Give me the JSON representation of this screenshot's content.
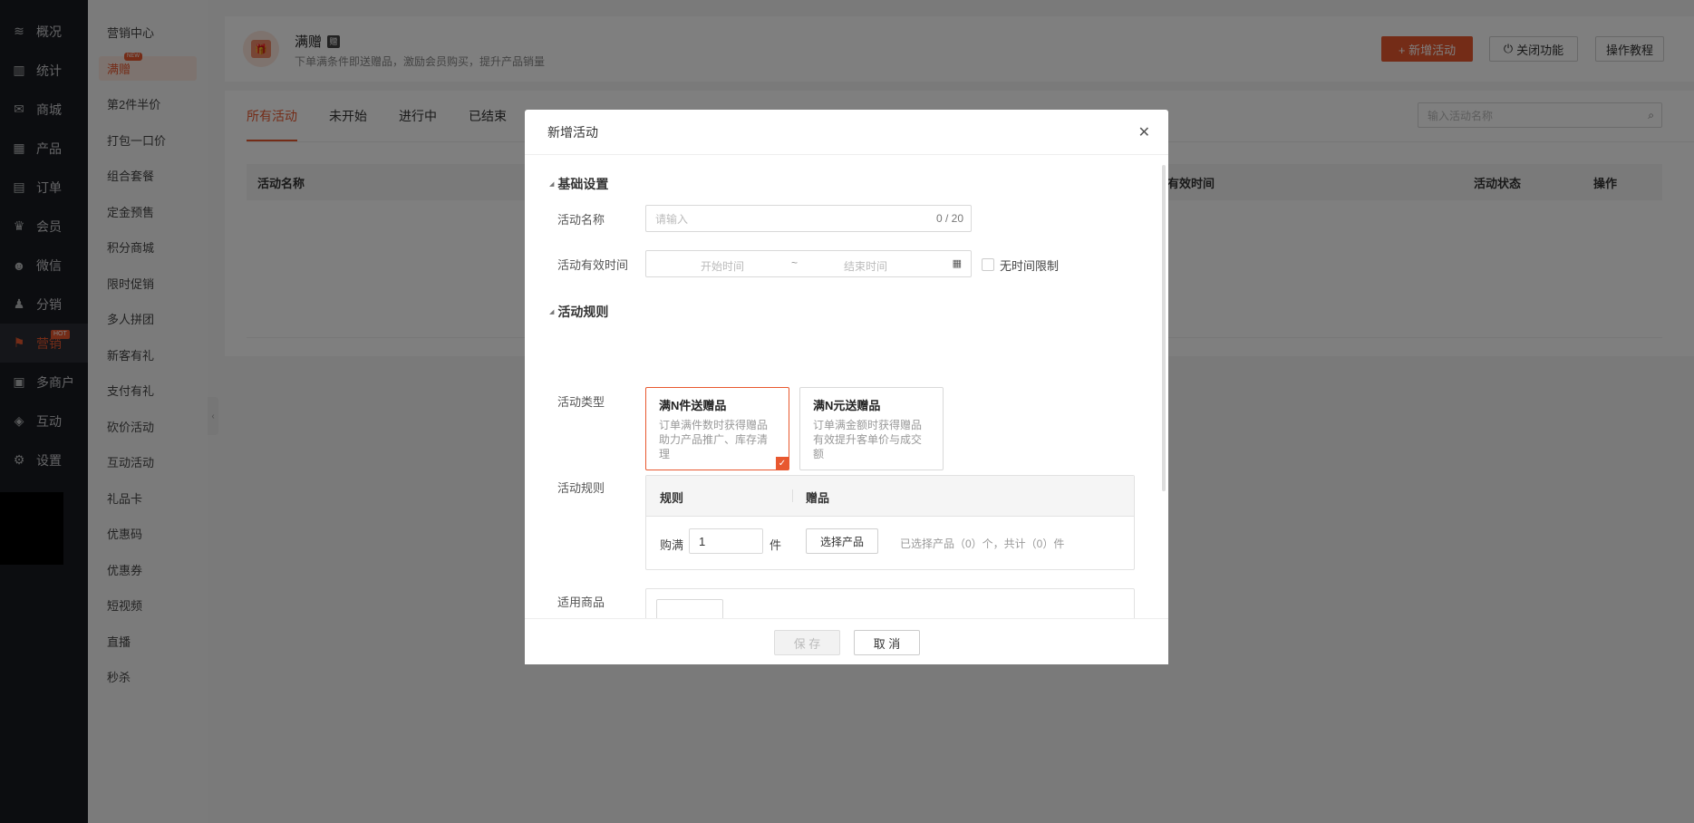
{
  "nav": {
    "items": [
      {
        "label": "概况",
        "icon": "layers-icon"
      },
      {
        "label": "统计",
        "icon": "chart-icon"
      },
      {
        "label": "商城",
        "icon": "mail-icon"
      },
      {
        "label": "产品",
        "icon": "grid-icon"
      },
      {
        "label": "订单",
        "icon": "clipboard-icon"
      },
      {
        "label": "会员",
        "icon": "crown-icon"
      },
      {
        "label": "微信",
        "icon": "wechat-icon"
      },
      {
        "label": "分销",
        "icon": "user-icon"
      },
      {
        "label": "营销",
        "icon": "flag-icon"
      },
      {
        "label": "多商户",
        "icon": "store-icon"
      },
      {
        "label": "互动",
        "icon": "interact-icon"
      },
      {
        "label": "设置",
        "icon": "gear-icon"
      }
    ],
    "hot_badge": "HOT"
  },
  "subnav": {
    "items": [
      "营销中心",
      "满赠",
      "第2件半价",
      "打包一口价",
      "组合套餐",
      "定金预售",
      "积分商城",
      "限时促销",
      "多人拼团",
      "新客有礼",
      "支付有礼",
      "砍价活动",
      "互动活动",
      "礼品卡",
      "优惠码",
      "优惠券",
      "短视频",
      "直播",
      "秒杀"
    ],
    "new_badge": "NEW"
  },
  "header": {
    "title": "满赠",
    "tag": "赠",
    "desc": "下单满条件即送赠品，激励会员购买，提升产品销量",
    "add_btn": "+ 新增活动",
    "close_btn": "关闭功能",
    "tutorial_btn": "操作教程"
  },
  "tabs": [
    "所有活动",
    "未开始",
    "进行中",
    "已结束"
  ],
  "search": {
    "placeholder": "输入活动名称"
  },
  "table": {
    "headers": [
      "活动名称",
      "有效时间",
      "活动状态",
      "操作"
    ]
  },
  "modal": {
    "title": "新增活动",
    "sec_basic": "基础设置",
    "name_label": "活动名称",
    "name_placeholder": "请输入",
    "name_count": "0 / 20",
    "time_label": "活动有效时间",
    "start_placeholder": "开始时间",
    "tilde": "~",
    "end_placeholder": "结束时间",
    "no_limit": "无时间限制",
    "sec_rules": "活动规则",
    "type_label": "活动类型",
    "type_cards": [
      {
        "title": "满N件送赠品",
        "desc": "订单满件数时获得赠品助力产品推广、库存清理"
      },
      {
        "title": "满N元送赠品",
        "desc": "订单满金额时获得赠品有效提升客单价与成交额"
      }
    ],
    "rules_label": "活动规则",
    "rules_header_rule": "规则",
    "rules_header_gift": "赠品",
    "buy_full": "购满",
    "qty": "1",
    "unit": "件",
    "choose_product": "选择产品",
    "selected_info": "已选择产品（0）个，共计（0）件",
    "goods_label": "适用商品",
    "plus": "+",
    "save": "保 存",
    "cancel": "取 消"
  },
  "colors": {
    "accent": "#e8582f",
    "nav_bg": "#191b21"
  }
}
